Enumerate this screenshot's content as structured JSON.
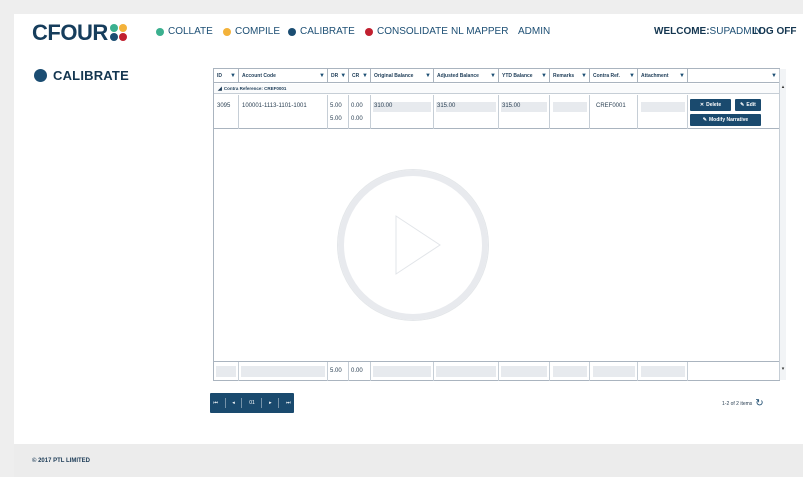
{
  "header": {
    "logo_text": "CFOUR",
    "nav": [
      {
        "label": "COLLATE",
        "color": "#3bb08f"
      },
      {
        "label": "COMPILE",
        "color": "#f3b23a"
      },
      {
        "label": "CALIBRATE",
        "color": "#1b4d72"
      },
      {
        "label": "CONSOLIDATE",
        "color": "#c1202f"
      },
      {
        "label": "NL MAPPER",
        "color": ""
      },
      {
        "label": "ADMIN",
        "color": ""
      }
    ],
    "welcome_label": "WELCOME:",
    "username": "SUPADMIN",
    "logoff_label": "LOG OFF"
  },
  "page": {
    "title": "CALIBRATE"
  },
  "grid": {
    "columns": [
      "ID",
      "Account Code",
      "DR",
      "CR",
      "Original Balance",
      "Adjusted Balance",
      "YTD Balance",
      "Remarks",
      "Contra Ref.",
      "Attachment",
      ""
    ],
    "group_label": "Contra Reference: CREF0001",
    "rows": [
      {
        "id": "3095",
        "account_code": "100001-1113-1101-1001",
        "dr": [
          "5.00",
          "5.00"
        ],
        "cr": [
          "0.00",
          "0.00"
        ],
        "original_balance": "310.00",
        "adjusted_balance": "315.00",
        "ytd_balance": "315.00",
        "remarks": "",
        "contra_ref": "CREF0001",
        "attachment": "",
        "actions": {
          "delete": "Delete",
          "edit": "Edit",
          "modify": "Modify Narrative"
        }
      }
    ],
    "totals": {
      "dr": "5.00",
      "cr": "0.00"
    }
  },
  "pager": {
    "current_page": "01",
    "items_text": "1-2 of 2 items"
  },
  "footer": {
    "copyright": "© 2017 PTL LIMITED"
  }
}
